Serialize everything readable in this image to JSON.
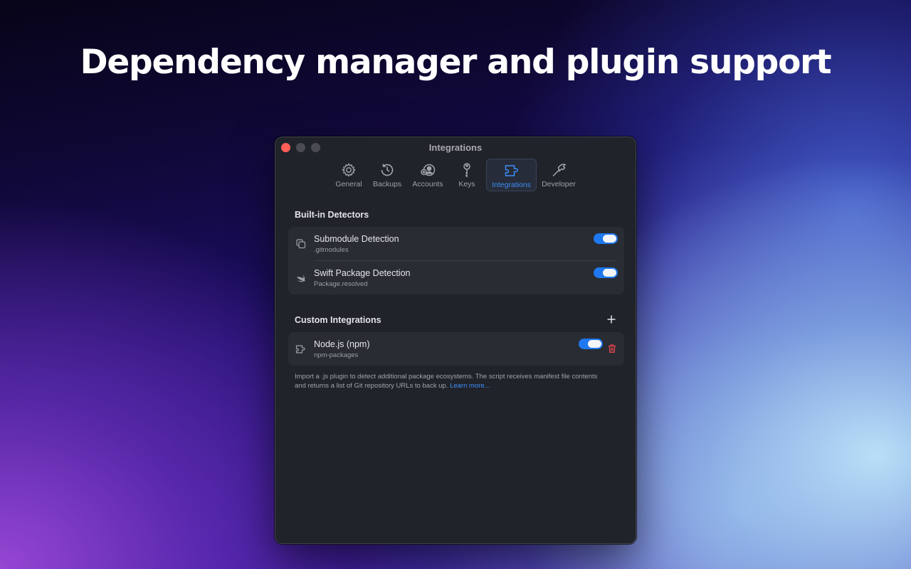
{
  "headline": "Dependency manager and plugin support",
  "window": {
    "title": "Integrations"
  },
  "toolbar": {
    "items": [
      {
        "label": "General",
        "icon": "gear-icon"
      },
      {
        "label": "Backups",
        "icon": "history-icon"
      },
      {
        "label": "Accounts",
        "icon": "accounts-icon"
      },
      {
        "label": "Keys",
        "icon": "key-icon"
      },
      {
        "label": "Integrations",
        "icon": "puzzle-icon",
        "active": true
      },
      {
        "label": "Developer",
        "icon": "hammer-icon"
      }
    ]
  },
  "builtin": {
    "title": "Built-in Detectors",
    "items": [
      {
        "name": "Submodule Detection",
        "sub": ".gitmodules",
        "icon": "copy-icon",
        "enabled": true
      },
      {
        "name": "Swift Package Detection",
        "sub": "Package.resolved",
        "icon": "swift-icon",
        "enabled": true
      }
    ]
  },
  "custom": {
    "title": "Custom Integrations",
    "items": [
      {
        "name": "Node.js (npm)",
        "sub": "npm-packages",
        "icon": "puzzle-icon",
        "enabled": true
      }
    ]
  },
  "note": {
    "text": "Import a .js plugin to detect additional package ecosystems. The script receives manifest file contents and returns a list of Git repository URLs to back up.",
    "link": "Learn more..."
  },
  "colors": {
    "accent": "#1f78f0",
    "link": "#3d8ef7",
    "danger": "#e0434b",
    "window_bg": "#20232a"
  }
}
